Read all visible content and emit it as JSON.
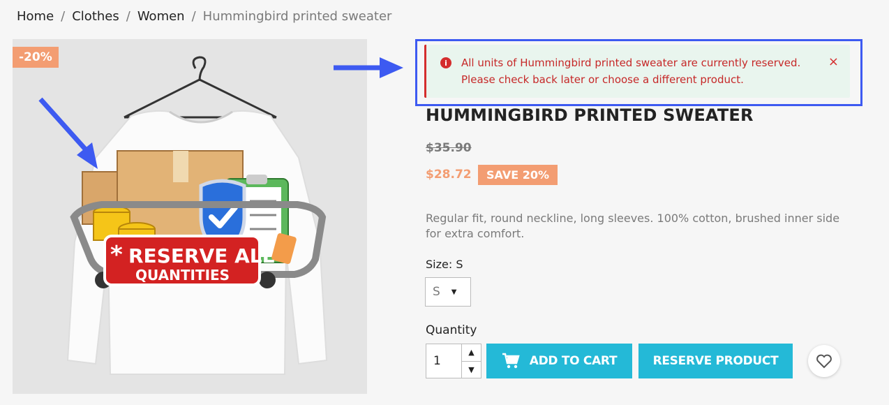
{
  "breadcrumb": {
    "home": "Home",
    "sep": "/",
    "clothes": "Clothes",
    "women": "Women",
    "current": "Hummingbird printed sweater"
  },
  "image": {
    "discount_flag": "-20%",
    "banner_line1": "RESERVE ALL",
    "banner_line2": "QUANTITIES",
    "banner_star": "*"
  },
  "alert": {
    "icon": "i",
    "message_line1": "All units of Hummingbird printed sweater are currently reserved.",
    "message_line2": "Please check back later or choose a different product.",
    "close": "×"
  },
  "product": {
    "title": "HUMMINGBIRD PRINTED SWEATER",
    "old_price": "$35.90",
    "new_price": "$28.72",
    "save_badge": "SAVE 20%",
    "description": "Regular fit, round neckline, long sleeves. 100% cotton, brushed inner side for extra comfort.",
    "size_label": "Size: S",
    "size_value": "S",
    "quantity_label": "Quantity",
    "quantity_value": "1"
  },
  "buttons": {
    "add_to_cart": "ADD TO CART",
    "reserve": "RESERVE PRODUCT"
  },
  "colors": {
    "accent": "#24b9d7",
    "sale": "#f39d72",
    "alert_red": "#d42d2d",
    "annotation_blue": "#3d5af1"
  }
}
